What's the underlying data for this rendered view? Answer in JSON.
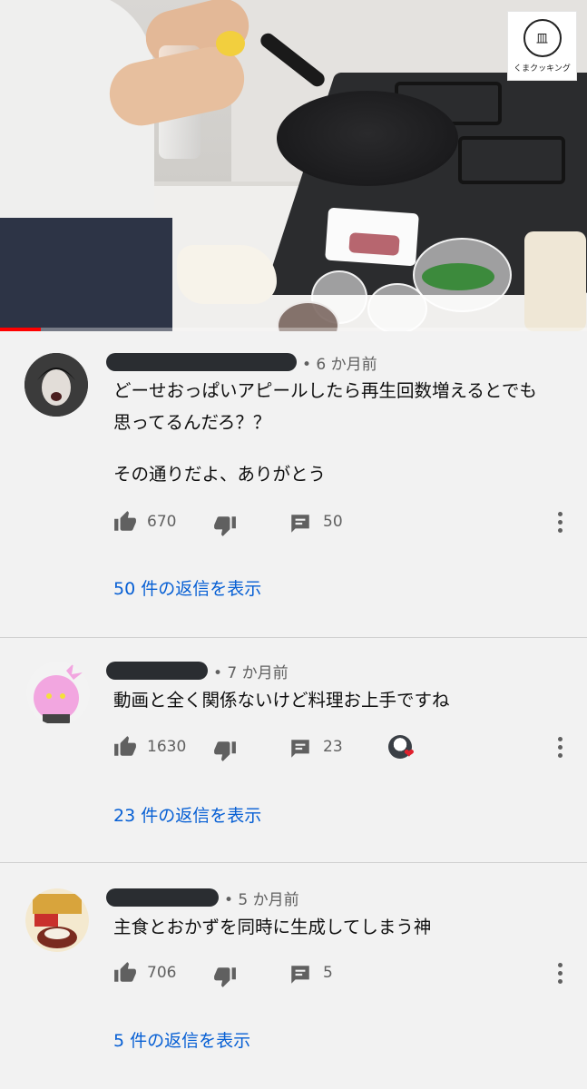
{
  "video": {
    "channel_watermark": "くまクッキング",
    "watermark_glyph": "皿",
    "progress_fraction": 0.07,
    "progress_color": "#ff0000"
  },
  "comments": [
    {
      "timestamp": "• 6 か月前",
      "text_lines": [
        "どーせおっぱいアピールしたら再生回数増えるとでも",
        "思ってるんだろ？？",
        "その通りだよ、ありがとう"
      ],
      "likes": "670",
      "reply_count": "50",
      "view_replies": "50 件の返信を表示",
      "creator_liked": false
    },
    {
      "timestamp": "• 7 か月前",
      "text_lines": [
        "動画と全く関係ないけど料理お上手ですね"
      ],
      "likes": "1630",
      "reply_count": "23",
      "view_replies": "23 件の返信を表示",
      "creator_liked": true
    },
    {
      "timestamp": "• 5 か月前",
      "text_lines": [
        "主食とおかずを同時に生成してしまう神"
      ],
      "likes": "706",
      "reply_count": "5",
      "view_replies": "5 件の返信を表示",
      "creator_liked": false
    }
  ],
  "icons": {
    "like": "thumbs-up-icon",
    "dislike": "thumbs-down-icon",
    "reply": "comment-icon",
    "more": "more-vert-icon",
    "creator_heart": "heart-icon"
  },
  "colors": {
    "link": "#065fd4",
    "secondary_text": "#606060",
    "background": "#f2f2f2",
    "heart": "#e0212d"
  }
}
